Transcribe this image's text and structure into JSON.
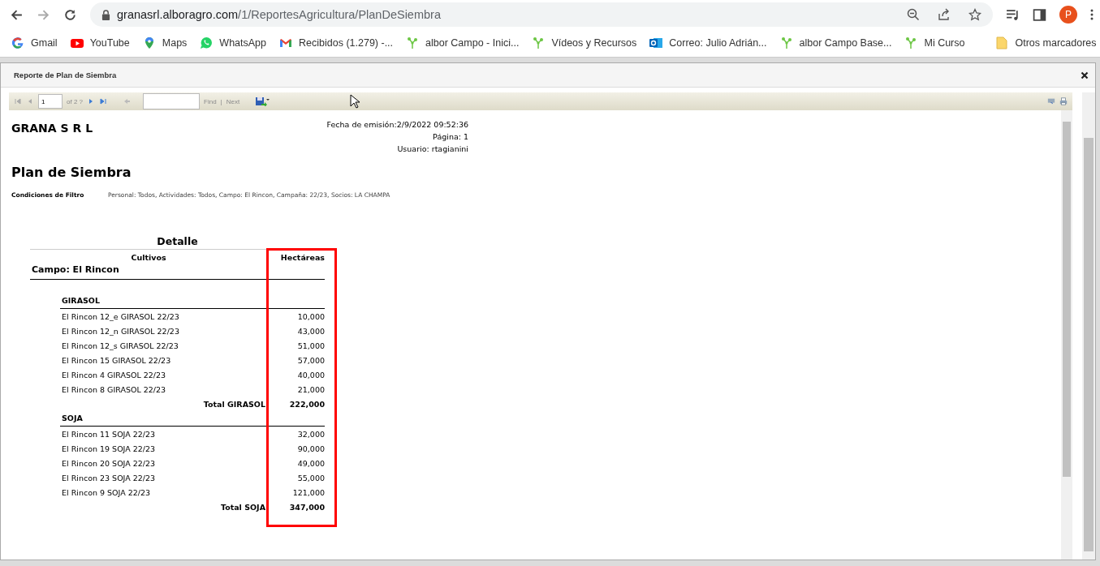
{
  "browser": {
    "url_host": "granasrl.alboragro.com",
    "url_path": "/1/ReportesAgricultura/PlanDeSiembra",
    "profile_initial": "P"
  },
  "bookmarks": [
    {
      "label": "Gmail",
      "kind": "google"
    },
    {
      "label": "YouTube",
      "kind": "youtube"
    },
    {
      "label": "Maps",
      "kind": "maps"
    },
    {
      "label": "WhatsApp",
      "kind": "whatsapp"
    },
    {
      "label": "Recibidos (1.279) -...",
      "kind": "gmail"
    },
    {
      "label": "albor Campo - Inici...",
      "kind": "sprout"
    },
    {
      "label": "Vídeos y Recursos",
      "kind": "sprout"
    },
    {
      "label": "Correo: Julio Adrián...",
      "kind": "outlook"
    },
    {
      "label": "albor Campo Base...",
      "kind": "sprout"
    },
    {
      "label": "Mi Curso",
      "kind": "sprout"
    }
  ],
  "other_bookmarks": "Otros marcadores",
  "dialog": {
    "title": "Reporte de Plan de Siembra"
  },
  "report_toolbar": {
    "page": "1",
    "page_count": "of 2 ?",
    "find": "Find",
    "separator": "|",
    "next": "Next"
  },
  "report": {
    "company": "GRANA S R L",
    "meta": [
      "Fecha de emisión:2/9/2022 09:52:36",
      "Página: 1",
      "Usuario: rtagianini"
    ],
    "title": "Plan de Siembra",
    "filter_label": "Condiciones de Filtro",
    "filter_text": "Personal: Todos, Actividades: Todos, Campo: El Rincon, Campaña: 22/23, Socios: LA CHAMPA",
    "detail": {
      "title": "Detalle",
      "columns": [
        "Cultivos",
        "Hectáreas"
      ],
      "group": "Campo: El Rincon",
      "crops": [
        {
          "name": "GIRASOL",
          "rows": [
            {
              "label": "El Rincon 12_e GIRASOL 22/23",
              "value": "10,000"
            },
            {
              "label": "El Rincon 12_n GIRASOL 22/23",
              "value": "43,000"
            },
            {
              "label": "El Rincon 12_s GIRASOL 22/23",
              "value": "51,000"
            },
            {
              "label": "El Rincon 15 GIRASOL 22/23",
              "value": "57,000"
            },
            {
              "label": "El Rincon 4 GIRASOL 22/23",
              "value": "40,000"
            },
            {
              "label": "El Rincon 8 GIRASOL 22/23",
              "value": "21,000"
            }
          ],
          "total_label": "Total GIRASOL",
          "total": "222,000"
        },
        {
          "name": "SOJA",
          "rows": [
            {
              "label": "El Rincon 11 SOJA 22/23",
              "value": "32,000"
            },
            {
              "label": "El Rincon 19 SOJA 22/23",
              "value": "90,000"
            },
            {
              "label": "El Rincon 20 SOJA 22/23",
              "value": "49,000"
            },
            {
              "label": "El Rincon 23 SOJA 22/23",
              "value": "55,000"
            },
            {
              "label": "El Rincon 9 SOJA 22/23",
              "value": "121,000"
            }
          ],
          "total_label": "Total SOJA",
          "total": "347,000"
        }
      ]
    }
  }
}
